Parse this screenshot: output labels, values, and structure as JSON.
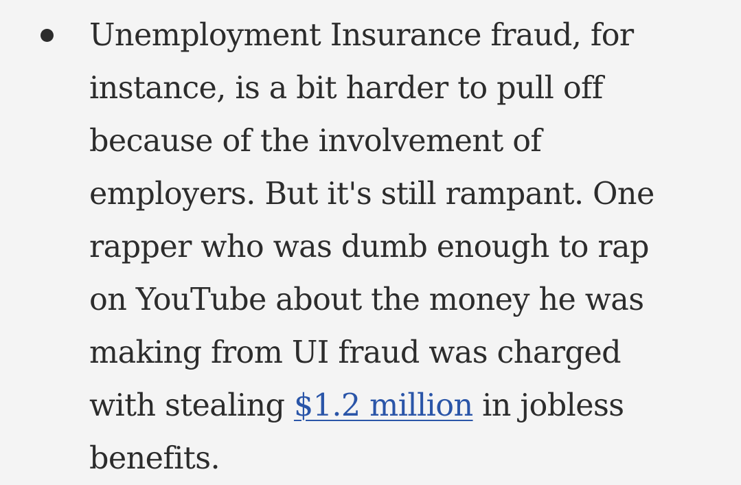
{
  "paragraph": {
    "line1": "Unemployment Insurance fraud, for",
    "line2": "instance, is a bit harder to pull off",
    "line3": "because of the involvement of",
    "line4": "employers. But it's still rampant. One",
    "line5": "rapper who was dumb enough to rap",
    "line6": "on YouTube about the money he was",
    "line7": "making from UI fraud was charged",
    "line8_before": "with stealing ",
    "link_text": "$1.2 million",
    "line8_after": " in jobless",
    "line9": "benefits."
  },
  "colors": {
    "background": "#f4f4f4",
    "text": "#2c2c2c",
    "link": "#2a55a8"
  },
  "icons": {
    "bullet": "bullet-dot-icon"
  }
}
